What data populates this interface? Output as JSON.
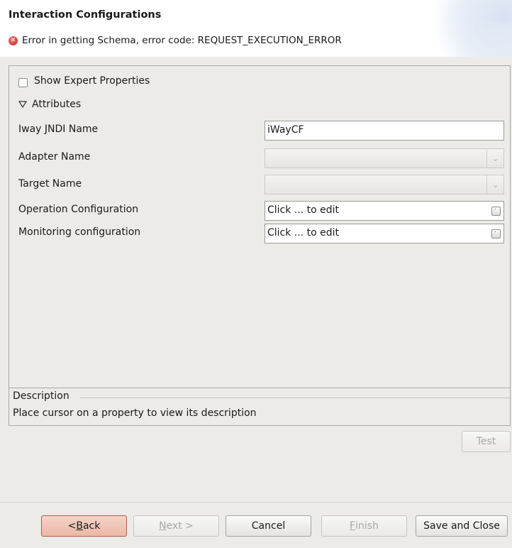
{
  "header": {
    "title": "Interaction Configurations",
    "error_message": "Error in getting Schema, error code: REQUEST_EXECUTION_ERROR",
    "error_icon": "error-icon",
    "error_color": "#c92020"
  },
  "options": {
    "show_expert_label": "Show Expert Properties",
    "show_expert_checked": false,
    "attributes_label": "Attributes"
  },
  "properties": [
    {
      "label": "Iway JNDI Name",
      "value": "iWayCF",
      "type": "text"
    },
    {
      "label": "Adapter Name",
      "value": "",
      "type": "combo-disabled"
    },
    {
      "label": "Target Name",
      "value": "",
      "type": "combo-disabled"
    },
    {
      "label": "Operation Configuration",
      "value": "Click ... to edit",
      "type": "dialog"
    },
    {
      "label": "Monitoring configuration",
      "value": "Click ... to edit",
      "type": "dialog"
    }
  ],
  "description": {
    "title": "Description",
    "text": "Place cursor on a property to view its description"
  },
  "buttons": {
    "test": "Test",
    "back_mnemonic": "B",
    "back_rest": "ack",
    "back_prefix": "< ",
    "next_mnemonic": "N",
    "next_rest": "ext >",
    "cancel": "Cancel",
    "finish_mnemonic": "F",
    "finish_rest": "inish",
    "save_close": "Save and Close"
  },
  "colors": {
    "background": "#ecebe8",
    "focused_button": "#ebb8a6"
  }
}
